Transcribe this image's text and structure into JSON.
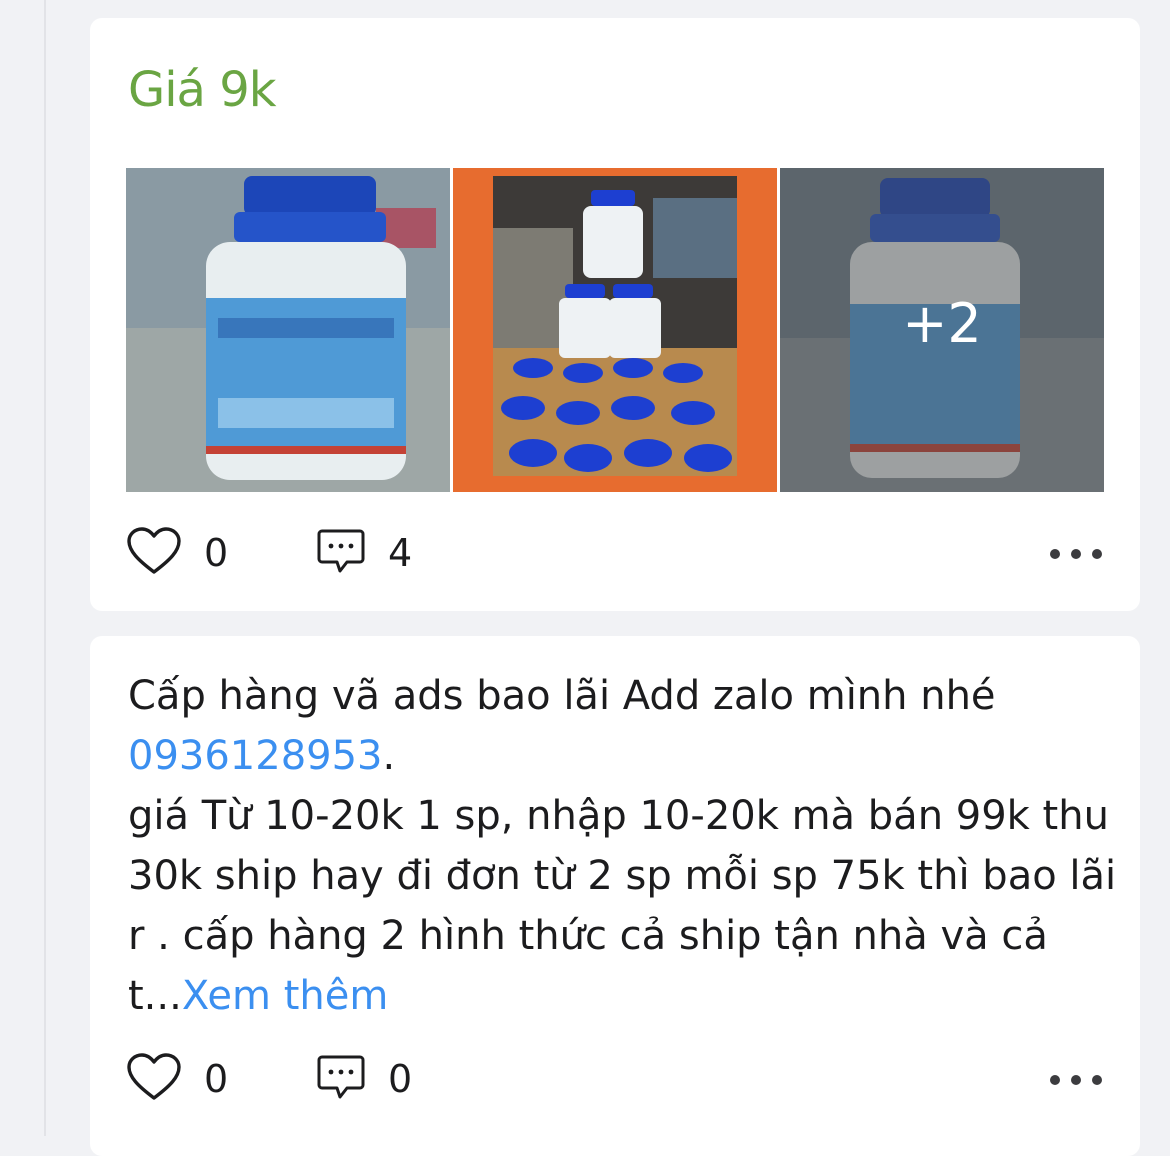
{
  "feed": {
    "posts": [
      {
        "title": "Giá 9k",
        "photos": [
          {
            "icon": "product-bottle-photo"
          },
          {
            "icon": "product-boxes-photo"
          },
          {
            "icon": "product-bottle-photo",
            "more_label": "+2"
          }
        ],
        "likes": "0",
        "comments": "4"
      },
      {
        "text_line1": "Cấp hàng vã ads bao lãi Add zalo mình nhé",
        "phone": "0936128953",
        "phone_suffix": ".",
        "text_rest": "giá Từ 10-20k 1 sp, nhập 10-20k mà bán 99k thu 30k ship hay đi đơn từ 2 sp mỗi sp 75k thì bao lãi r . cấp hàng 2 hình thức cả ship tận nhà và cả t...",
        "see_more": "Xem thêm",
        "likes": "0",
        "comments": "0"
      }
    ]
  },
  "colors": {
    "title_green": "#6aa543",
    "link_blue": "#3b8ff0",
    "background": "#f1f2f5",
    "card": "#ffffff"
  }
}
